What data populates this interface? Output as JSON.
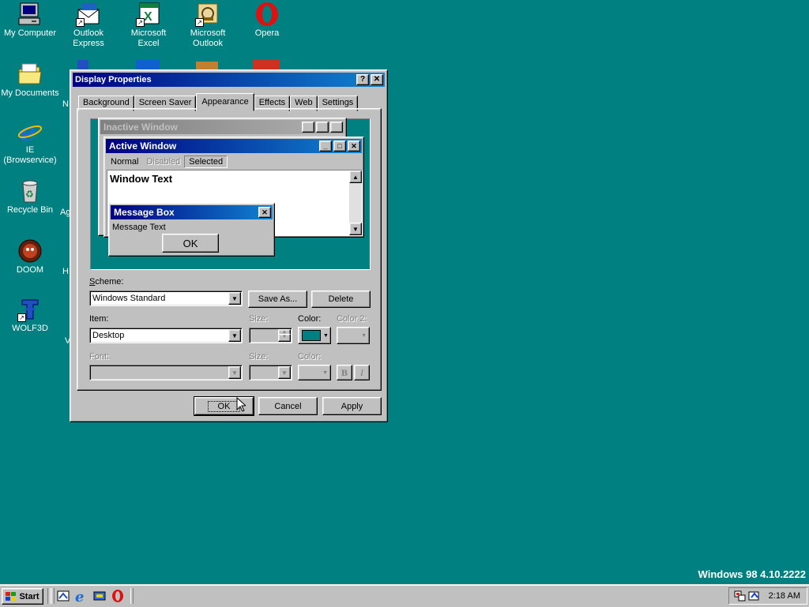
{
  "desktop": {
    "icons": [
      {
        "label_lines": [
          "My Computer"
        ],
        "icon": "computer-icon"
      },
      {
        "label_lines": [
          "Outlook",
          "Express"
        ],
        "icon": "outlook-express-icon"
      },
      {
        "label_lines": [
          "Microsoft",
          "Excel"
        ],
        "icon": "excel-icon"
      },
      {
        "label_lines": [
          "Microsoft",
          "Outlook"
        ],
        "icon": "outlook-icon"
      },
      {
        "label_lines": [
          "Opera"
        ],
        "icon": "opera-icon"
      },
      {
        "label_lines": [
          "My Documents"
        ],
        "icon": "folder-icon"
      },
      {
        "label_lines": [
          "IE",
          "(Browservice)"
        ],
        "icon": "internet-explorer-icon"
      },
      {
        "label_lines": [
          "Recycle Bin"
        ],
        "icon": "recycle-bin-icon"
      },
      {
        "label_lines": [
          "DOOM"
        ],
        "icon": "doom-icon"
      },
      {
        "label_lines": [
          "WOLF3D"
        ],
        "icon": "wolf3d-icon"
      }
    ],
    "partial_labels": [
      "N",
      "Ag",
      "H",
      "V"
    ],
    "version": "Windows 98 4.10.2222",
    "background_color": "#008080"
  },
  "dialog": {
    "title": "Display Properties",
    "help_button": "?",
    "close_button": "✕",
    "tabs": [
      "Background",
      "Screen Saver",
      "Appearance",
      "Effects",
      "Web",
      "Settings"
    ],
    "active_tab": "Appearance",
    "preview": {
      "inactive_title": "Inactive Window",
      "active_title": "Active Window",
      "menu": [
        "Normal",
        "Disabled",
        "Selected"
      ],
      "window_text": "Window Text",
      "message_title": "Message Box",
      "message_text": "Message Text",
      "ok": "OK"
    },
    "scheme_label": "Scheme:",
    "scheme_value": "Windows Standard",
    "save_as": "Save As...",
    "delete": "Delete",
    "item_label": "Item:",
    "item_value": "Desktop",
    "size_label": "Size:",
    "color_label": "Color:",
    "color2_label": "Color 2:",
    "font_label": "Font:",
    "font_size_label": "Size:",
    "font_color_label": "Color:",
    "bold": "B",
    "italic": "I",
    "selected_color": "#008080",
    "ok": "OK",
    "cancel": "Cancel",
    "apply": "Apply"
  },
  "taskbar": {
    "start": "Start",
    "quick_launch": [
      "show-desktop-icon",
      "internet-explorer-icon",
      "channels-icon",
      "opera-icon"
    ],
    "clock": "2:18 AM"
  }
}
